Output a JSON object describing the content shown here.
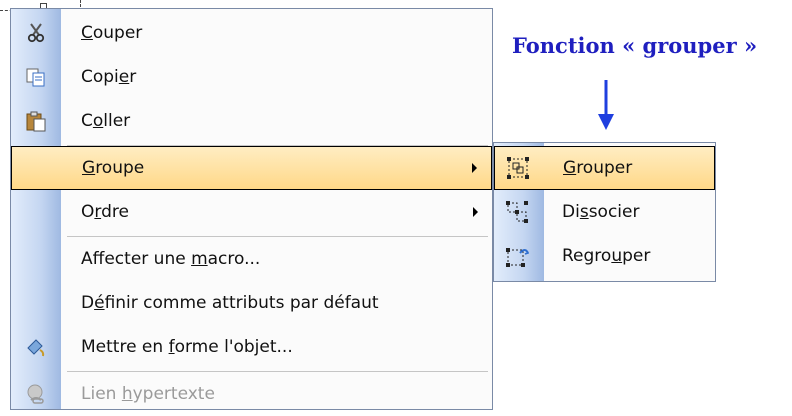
{
  "annotation": {
    "text": "Fonction « grouper »",
    "color": "#1f1fbf"
  },
  "menu": {
    "items": [
      {
        "label_pre": "",
        "mnemonic": "C",
        "label_post": "ouper",
        "icon": "scissors-icon",
        "state": "normal"
      },
      {
        "label_pre": "Copi",
        "mnemonic": "e",
        "label_post": "r",
        "icon": "copy-icon",
        "state": "normal"
      },
      {
        "label_pre": "C",
        "mnemonic": "o",
        "label_post": "ller",
        "icon": "paste-icon",
        "state": "normal"
      },
      {
        "label_pre": "",
        "mnemonic": "G",
        "label_post": "roupe",
        "icon": "",
        "state": "highlighted",
        "submenu": true
      },
      {
        "label_pre": "O",
        "mnemonic": "r",
        "label_post": "dre",
        "icon": "",
        "state": "normal",
        "submenu": true
      },
      {
        "label_pre": "Affecter une ",
        "mnemonic": "m",
        "label_post": "acro...",
        "icon": "",
        "state": "normal"
      },
      {
        "label_pre": "D",
        "mnemonic": "é",
        "label_post": "finir comme attributs par défaut",
        "icon": "",
        "state": "normal"
      },
      {
        "label_pre": "Mettre en ",
        "mnemonic": "f",
        "label_post": "orme l'objet...",
        "icon": "format-object-icon",
        "state": "normal"
      },
      {
        "label_pre": "Lien ",
        "mnemonic": "h",
        "label_post": "ypertexte",
        "icon": "hyperlink-icon",
        "state": "disabled"
      }
    ]
  },
  "submenu": {
    "items": [
      {
        "label_pre": "",
        "mnemonic": "G",
        "label_post": "rouper",
        "icon": "group-icon",
        "state": "highlighted"
      },
      {
        "label_pre": "Di",
        "mnemonic": "s",
        "label_post": "socier",
        "icon": "ungroup-icon",
        "state": "normal"
      },
      {
        "label_pre": "Regro",
        "mnemonic": "u",
        "label_post": "per",
        "icon": "regroup-icon",
        "state": "normal"
      }
    ]
  },
  "colors": {
    "highlight_top": "#ffedc2",
    "highlight_bottom": "#ffd888",
    "gutter": "#c4d6f1",
    "menu_border": "#7a8aa6"
  }
}
